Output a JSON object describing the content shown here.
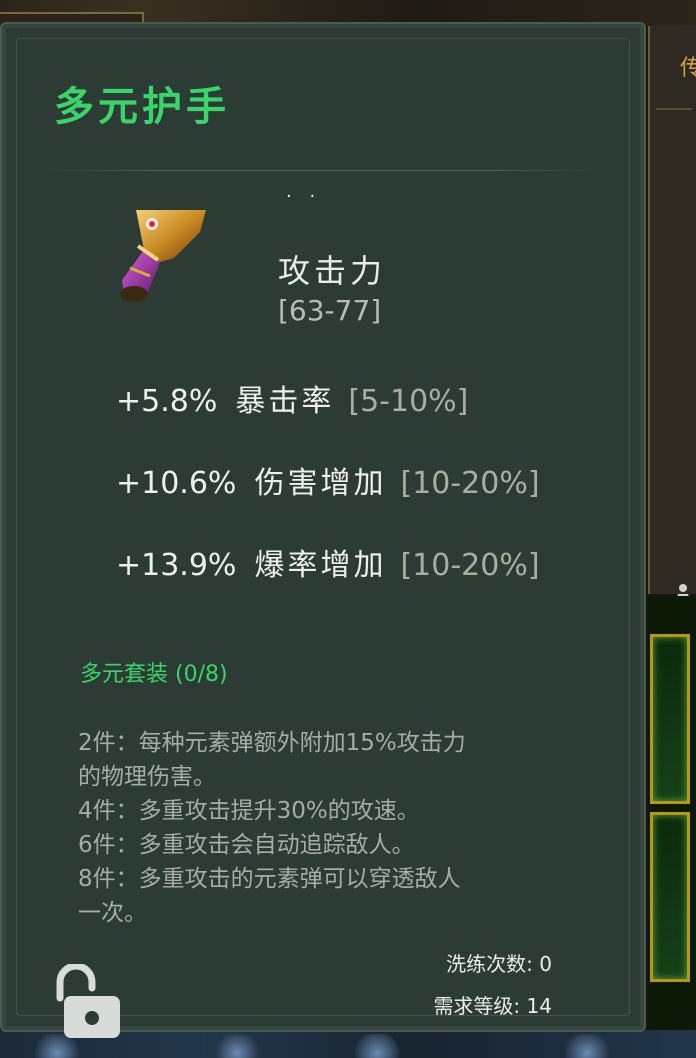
{
  "item": {
    "name": "多元护手",
    "base_stat_name": "攻击力",
    "base_stat_range": "[63-77]",
    "top_dots": "· ·"
  },
  "affixes": [
    {
      "value": "+5.8%",
      "name": "暴击率",
      "range": "[5-10%]"
    },
    {
      "value": "+10.6%",
      "name": "伤害增加",
      "range": "[10-20%]"
    },
    {
      "value": "+13.9%",
      "name": "爆率增加",
      "range": "[10-20%]"
    }
  ],
  "set": {
    "title": "多元套装 (0/8)",
    "lines": [
      "2件：每种元素弹额外附加15%攻击力",
      "的物理伤害。",
      "4件：多重攻击提升30%的攻速。",
      "6件：多重攻击会自动追踪敌人。",
      "8件：多重攻击的元素弹可以穿透敌人",
      "一次。"
    ]
  },
  "footer": {
    "refine_label": "洗练次数:",
    "refine_value": "0",
    "level_label": "需求等级:",
    "level_value": "14"
  },
  "side_panel": {
    "tab_char": "传"
  },
  "icons": {
    "item": "gauntlet-icon",
    "lock": "unlocked-padlock-icon",
    "side": "character-icon"
  },
  "colors": {
    "title": "#39d46a",
    "set_title": "#3bd46b",
    "panel_bg": "#2c3c34"
  }
}
